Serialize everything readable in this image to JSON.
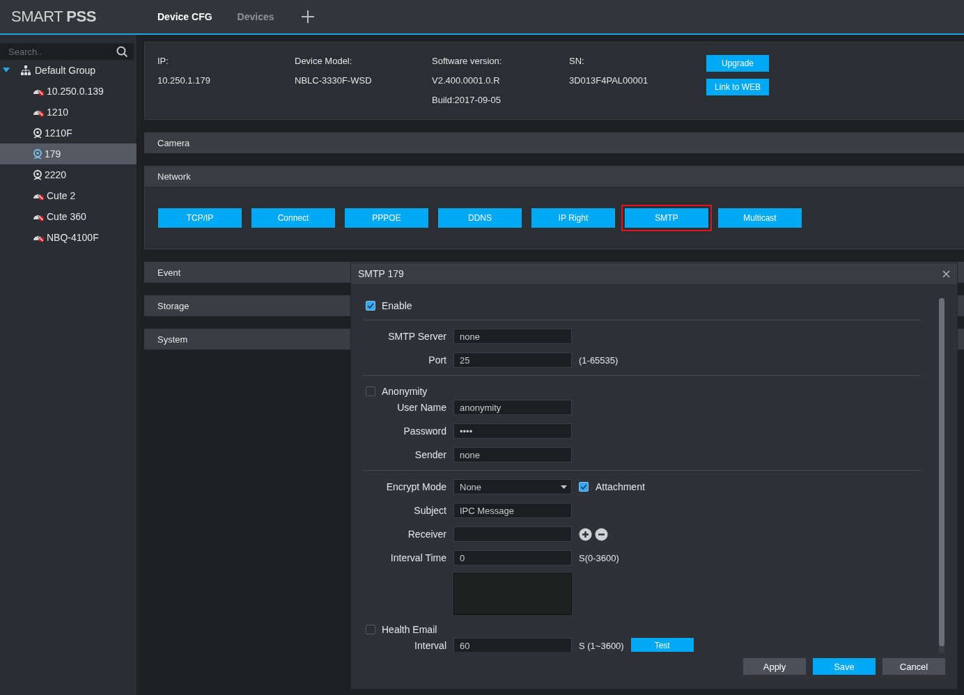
{
  "app": {
    "logo": "SMART **PSS**"
  },
  "tabs": [
    {
      "label": "Device CFG",
      "selected": true
    },
    {
      "label": "Devices",
      "selected": false
    }
  ],
  "sidebar": {
    "search": {
      "placeholder": "Search.."
    },
    "tree": [
      {
        "label": "Default Group",
        "expanded": true,
        "children": [
          {
            "label": "10.250.0.139",
            "kind": "offline",
            "selected": false
          },
          {
            "label": "1210",
            "kind": "offline",
            "selected": false
          },
          {
            "label": "1210F",
            "kind": "online",
            "selected": false
          },
          {
            "label": "179",
            "kind": "online",
            "selected": true
          },
          {
            "label": "2220",
            "kind": "online",
            "selected": false
          },
          {
            "label": "Cute 2",
            "kind": "offline",
            "selected": false
          },
          {
            "label": "Cute 360",
            "kind": "offline",
            "selected": false
          },
          {
            "label": "NBQ-4100F",
            "kind": "offline",
            "selected": false
          }
        ]
      }
    ]
  },
  "device_info": {
    "fields": [
      {
        "label": "IP:",
        "values": [
          "10.250.1.179"
        ]
      },
      {
        "label": "Device Model:",
        "values": [
          "NBLC-3330F-WSD"
        ]
      },
      {
        "label": "Software version:",
        "values": [
          "V2.400.0001.0.R",
          "Build:2017-09-05"
        ]
      },
      {
        "label": "SN:",
        "values": [
          "3D013F4PAL00001"
        ]
      }
    ],
    "buttons": [
      "Upgrade",
      "Link to WEB"
    ]
  },
  "sections": [
    {
      "title": "Camera",
      "kind": "bar"
    },
    {
      "title": "Network",
      "kind": "panel",
      "buttons": [
        {
          "label": "TCP/IP",
          "selected": false
        },
        {
          "label": "Connect",
          "selected": false
        },
        {
          "label": "PPPOE",
          "selected": false
        },
        {
          "label": "DDNS",
          "selected": false
        },
        {
          "label": "IP Right",
          "selected": false
        },
        {
          "label": "SMTP",
          "selected": true
        },
        {
          "label": "Multicast",
          "selected": false
        }
      ]
    },
    {
      "title": "Event",
      "kind": "bar"
    },
    {
      "title": "Storage",
      "kind": "bar"
    },
    {
      "title": "System",
      "kind": "bar"
    }
  ],
  "dialog": {
    "title": "SMTP 179",
    "rows": [
      {
        "kind": "checkbox",
        "label": "Enable",
        "checked": true
      },
      {
        "kind": "divider"
      },
      {
        "kind": "field",
        "label": "SMTP Server",
        "value": "none"
      },
      {
        "kind": "field",
        "label": "Port",
        "value": "25",
        "hint": "(1-65535)"
      },
      {
        "kind": "divider"
      },
      {
        "kind": "checkbox",
        "label": "Anonymity",
        "checked": false
      },
      {
        "kind": "field",
        "label": "User Name",
        "value": "anonymity"
      },
      {
        "kind": "field",
        "label": "Password",
        "value": "••••"
      },
      {
        "kind": "field",
        "label": "Sender",
        "value": "none"
      },
      {
        "kind": "divider"
      },
      {
        "kind": "select",
        "label": "Encrypt Mode",
        "value": "None",
        "option": {
          "label": "Attachment",
          "checked": true
        }
      },
      {
        "kind": "field",
        "label": "Subject",
        "value": "IPC Message"
      },
      {
        "kind": "field",
        "label": "Receiver",
        "add_remove": true
      },
      {
        "kind": "field",
        "label": "Interval Time",
        "value": "0",
        "hint": "S(0-3600)"
      },
      {
        "kind": "textarea"
      },
      {
        "kind": "checkbox",
        "label": "Health Email",
        "checked": false
      },
      {
        "kind": "field",
        "label": "Interval",
        "value": "60",
        "hint": "S (1~3600)",
        "button": "Test"
      }
    ],
    "buttons": [
      {
        "label": "Apply",
        "kind": "secondary"
      },
      {
        "label": "Save",
        "kind": "primary"
      },
      {
        "label": "Cancel",
        "kind": "secondary"
      }
    ]
  }
}
